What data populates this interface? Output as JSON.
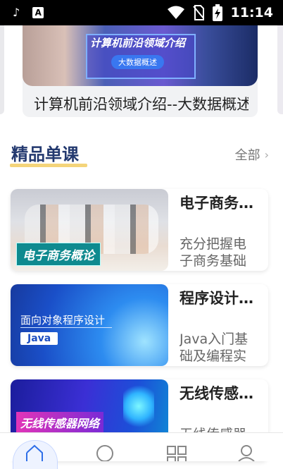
{
  "status_bar": {
    "time": "11:14",
    "left_icons": [
      "tiktok-icon",
      "a-icon"
    ],
    "right_icons": [
      "wifi-icon",
      "no-sim-icon",
      "battery-charging-icon"
    ],
    "a_glyph": "A"
  },
  "banner": {
    "sign_text": "计算机前沿领域介绍",
    "sign_badge": "大数据概述",
    "title": "计算机前沿领域介绍--大数据概述"
  },
  "section": {
    "title": "精品单课",
    "more_label": "全部",
    "accent_color": "#f4d47a",
    "title_color": "#23396f"
  },
  "courses": [
    {
      "title": "电子商务概论",
      "description": "充分把握电子商务基础知识",
      "thumb_label": "电子商务概论"
    },
    {
      "title": "程序设计基础",
      "description": "Java入门基础及编程实践",
      "thumb_text": "面向对象程序设计",
      "thumb_tag": "Java"
    },
    {
      "title": "无线传感器网络",
      "description": "无线传感器网络",
      "thumb_label": "无线传感器网络"
    }
  ],
  "tabbar": {
    "tabs": [
      "home-icon",
      "discover-icon",
      "category-icon",
      "profile-icon"
    ],
    "active": "home-icon"
  }
}
